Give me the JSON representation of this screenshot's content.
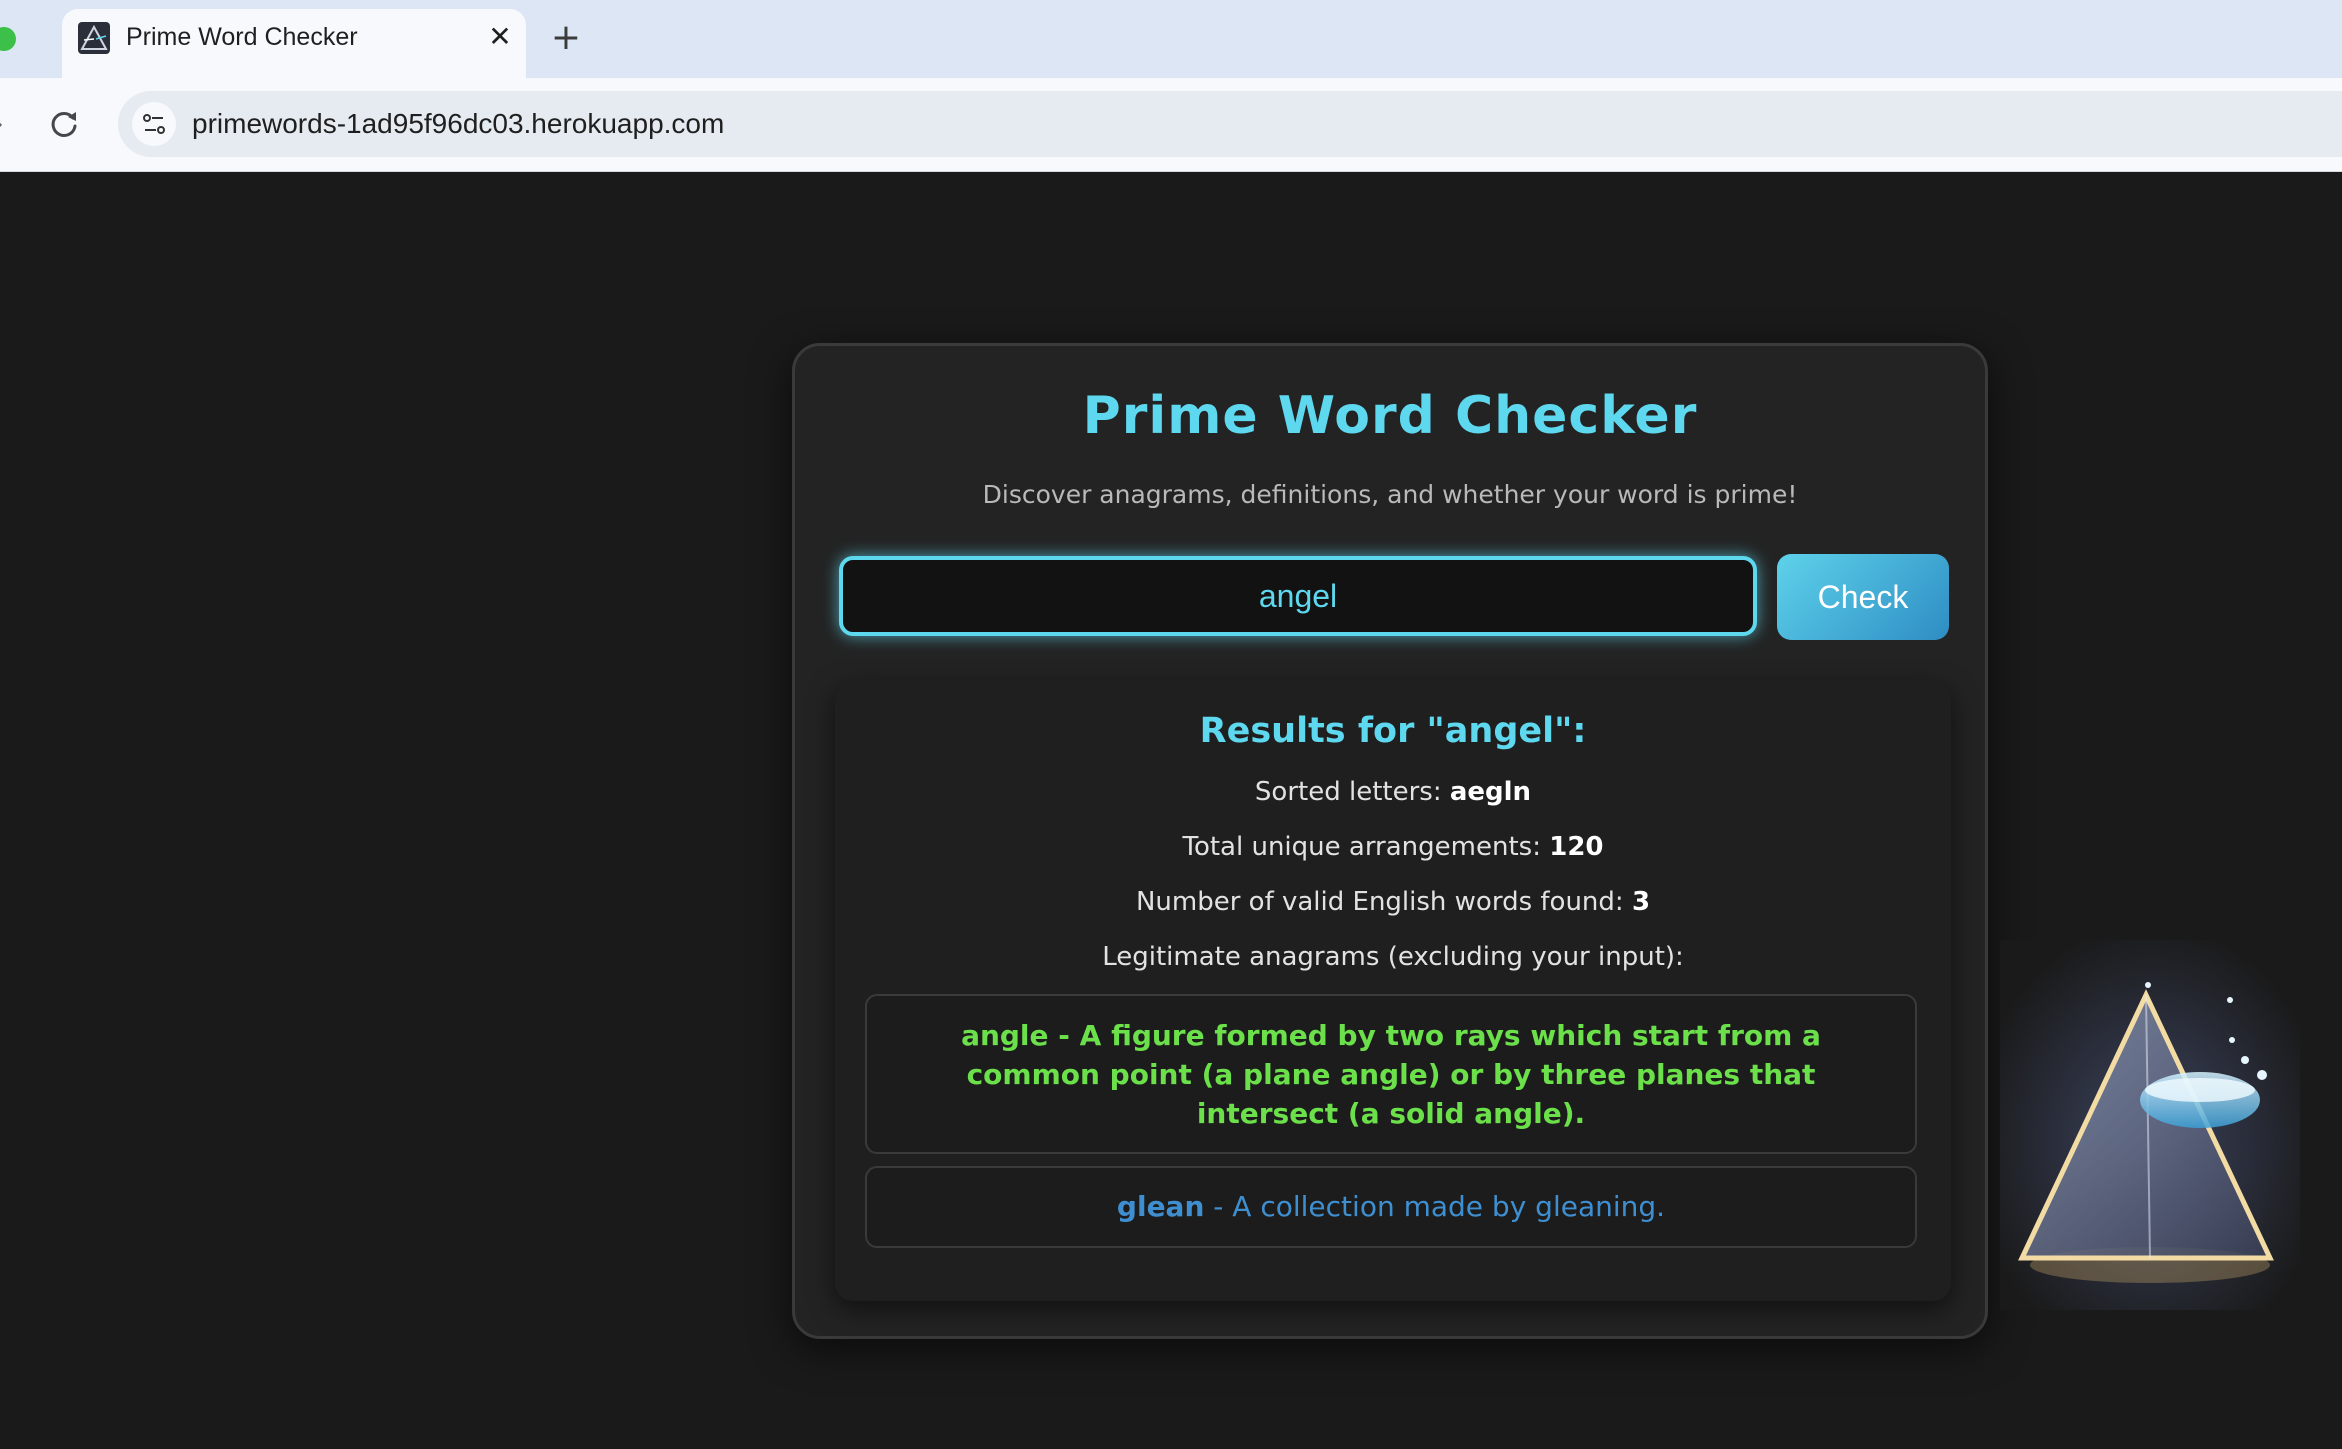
{
  "browser": {
    "tab_title": "Prime Word Checker",
    "tab_close": "✕",
    "new_tab": "+",
    "url": "primewords-1ad95f96dc03.herokuapp.com"
  },
  "page": {
    "title": "Prime Word Checker",
    "subtitle": "Discover anagrams, definitions, and whether your word is prime!",
    "input_value": "angel",
    "check_label": "Check",
    "results": {
      "heading": "Results for \"angel\":",
      "sorted_label": "Sorted letters:",
      "sorted_value": "aegln",
      "total_label": "Total unique arrangements:",
      "total_value": "120",
      "valid_label": "Number of valid English words found:",
      "valid_value": "3",
      "legit_label": "Legitimate anagrams (excluding your input):",
      "anagrams": [
        {
          "word": "angle",
          "definition": "A figure formed by two rays which start from a common point (a plane angle) or by three planes that intersect (a solid angle).",
          "color": "#6be04a"
        },
        {
          "word": "glean",
          "definition": "A collection made by gleaning.",
          "color": "#3f8fd0"
        }
      ]
    }
  },
  "colors": {
    "accent": "#5ed8ef",
    "background": "#1a1a1a",
    "card": "#232323"
  },
  "icons": {
    "favicon": "prism-favicon-icon",
    "reload": "reload-icon",
    "site_info": "site-settings-icon",
    "art": "prism-image"
  }
}
